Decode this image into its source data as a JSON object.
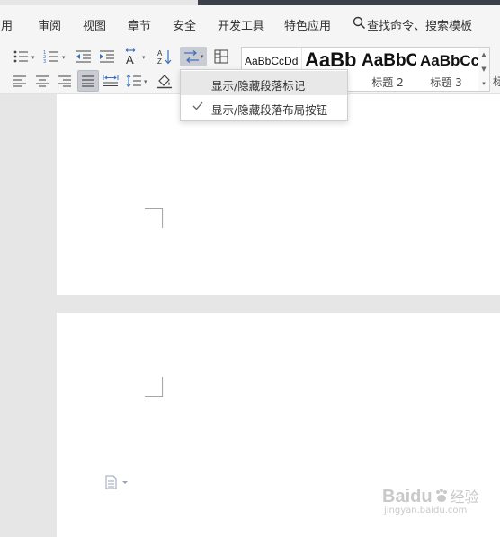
{
  "menu": {
    "items": [
      "引用",
      "审阅",
      "视图",
      "章节",
      "安全",
      "开发工具",
      "特色应用"
    ],
    "search_label": "查找命令、搜索模板"
  },
  "styles": [
    {
      "sample": "AaBbCcDd",
      "name": ""
    },
    {
      "sample": "AaBb",
      "name": ""
    },
    {
      "sample": "AaBbC",
      "name": "标题 2"
    },
    {
      "sample": "AaBbCc",
      "name": "标题 3"
    }
  ],
  "right_fragment": "标",
  "popup": {
    "items": [
      {
        "label": "显示/隐藏段落标记",
        "checked": false,
        "hovered": true
      },
      {
        "label": "显示/隐藏段落布局按钮",
        "checked": true,
        "hovered": false
      }
    ]
  },
  "watermark": {
    "brand": "Baidu",
    "suffix": "经验",
    "url": "jingyan.baidu.com"
  },
  "colors": {
    "menubar": "#f5f5f5",
    "canvas": "#e6e6e6",
    "page": "#ffffff",
    "active_btn": "#c9ccd2"
  }
}
